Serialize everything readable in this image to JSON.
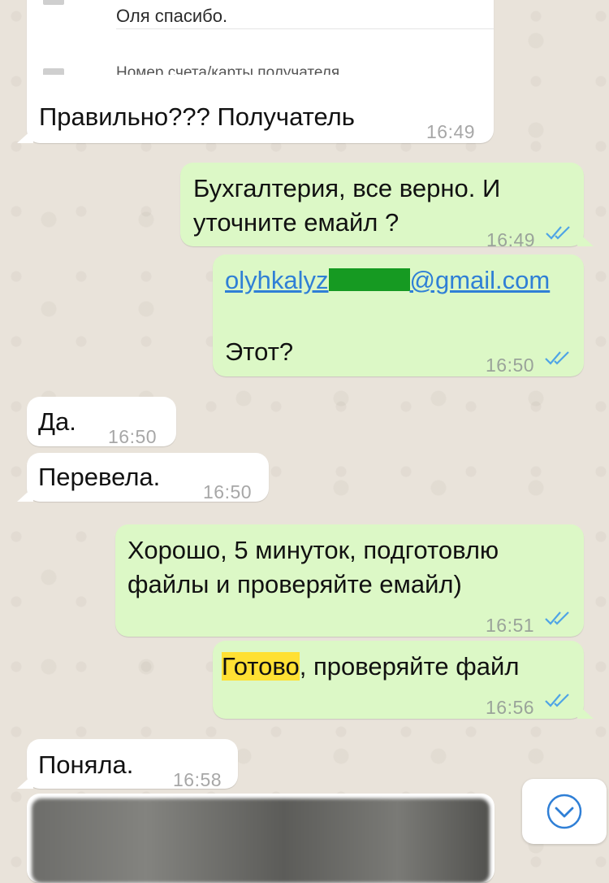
{
  "messages": [
    {
      "id": "m1",
      "dir": "in",
      "quote": {
        "line1": "Оля  спасибо.",
        "line2": "Номер счета/карты получателя"
      },
      "text": "Правильно??? Получатель",
      "time": "16:49"
    },
    {
      "id": "m2",
      "dir": "out",
      "line1": "Бухгалтерия, все верно. И",
      "line2": "уточните емайл ?",
      "time": "16:49"
    },
    {
      "id": "m3",
      "dir": "out",
      "link_start": "olyhkaly",
      "link_end": "@gmail.com",
      "text": "Этот?",
      "time": "16:50"
    },
    {
      "id": "m4",
      "dir": "in",
      "text": "Да.",
      "time": "16:50"
    },
    {
      "id": "m5",
      "dir": "in",
      "text": "Перевела.",
      "time": "16:50"
    },
    {
      "id": "m6",
      "dir": "out",
      "line1": "Хорошо, 5 минуток, подготовлю",
      "line2": "файлы и проверяйте емайл)",
      "time": "16:51"
    },
    {
      "id": "m7",
      "dir": "out",
      "highlight": "Готово",
      "rest": ", проверяйте файл",
      "time": "16:56"
    },
    {
      "id": "m8",
      "dir": "in",
      "text": "Поняла.",
      "time": "16:58"
    }
  ],
  "icons": {
    "read_receipt": "double-check-icon",
    "scroll_down": "chevron-down-circle-icon"
  },
  "colors": {
    "incoming": "#ffffff",
    "outgoing": "#dcf8c6",
    "tick": "#4fa4e6",
    "link": "#2f7fd6",
    "highlight": "#ffe033",
    "redaction": "#169a22"
  }
}
